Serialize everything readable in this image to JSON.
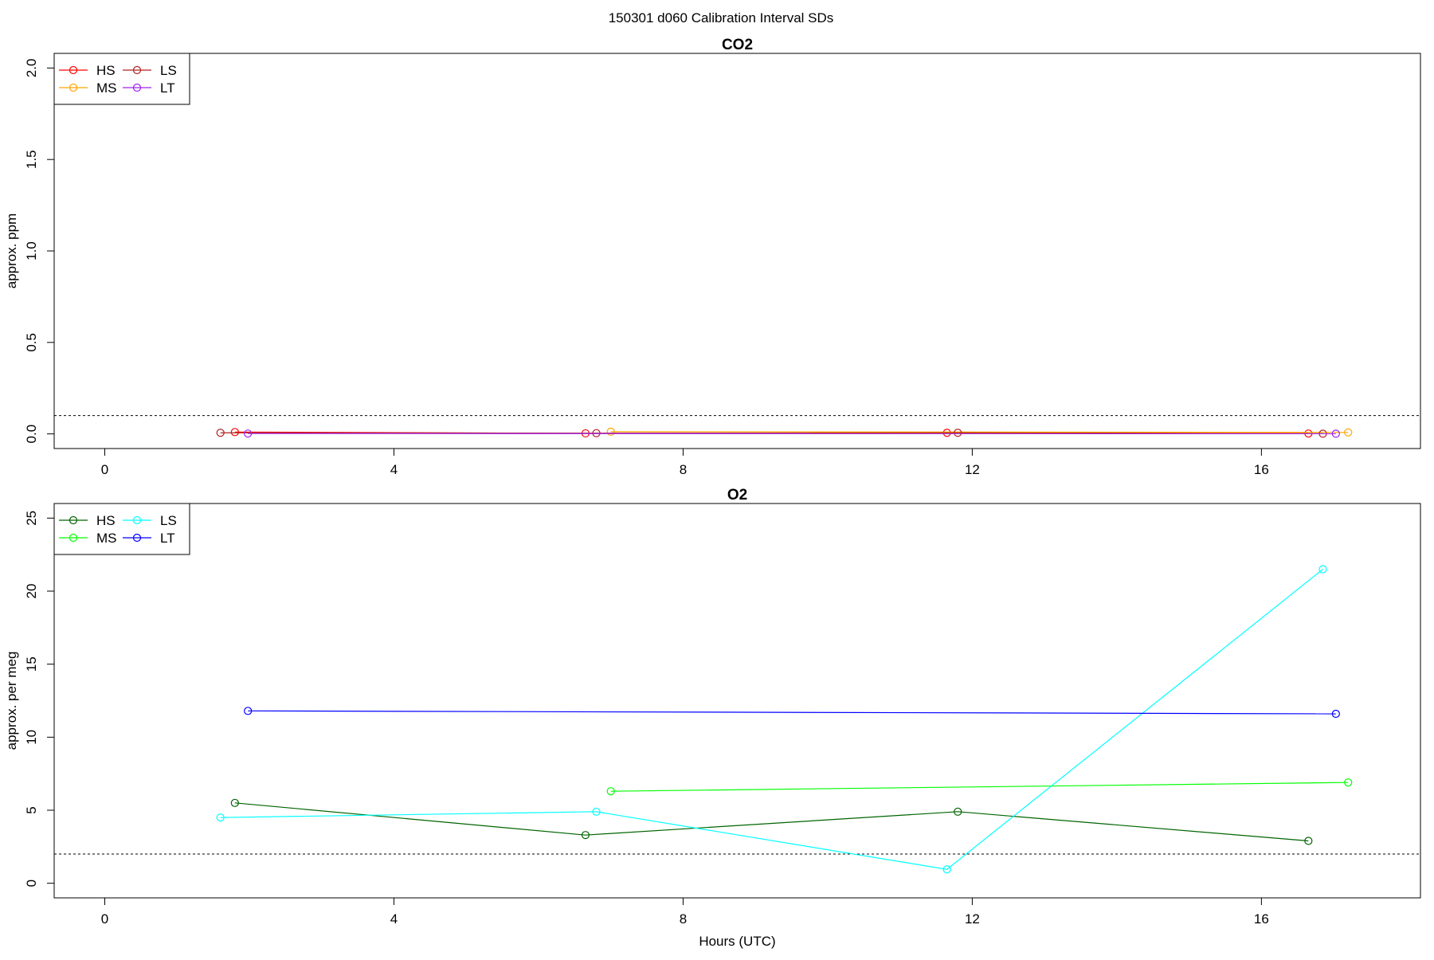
{
  "figure": {
    "suptitle": "150301   d060   Calibration Interval SDs"
  },
  "colors": {
    "HS_co2": "#ff0000",
    "MS_co2": "#ffa500",
    "LS_co2": "#b22222",
    "LT_co2": "#a020f0",
    "HS_o2": "#006400",
    "MS_o2": "#00ff00",
    "LS_o2": "#00ffff",
    "LT_o2": "#0000ff"
  },
  "chart_data": [
    {
      "type": "line",
      "title": "CO2",
      "xlabel": "",
      "ylabel": "approx. ppm",
      "xlim": [
        -0.7,
        18.2
      ],
      "ylim": [
        -0.08,
        2.08
      ],
      "xticks": [
        0,
        4,
        8,
        12,
        16
      ],
      "yticks": [
        0.0,
        0.5,
        1.0,
        1.5,
        2.0
      ],
      "ytick_labels": [
        "0.0",
        "0.5",
        "1.0",
        "1.5",
        "2.0"
      ],
      "threshold": 0.1,
      "grid": false,
      "legend": {
        "position": "top-left",
        "columns": 2
      },
      "series": [
        {
          "name": "HS",
          "color": "#ff0000",
          "x": [
            1.8,
            6.65,
            11.65,
            16.65
          ],
          "y": [
            0.01,
            0.003,
            0.006,
            0.002
          ]
        },
        {
          "name": "MS",
          "color": "#ffa500",
          "x": [
            7.0,
            17.2
          ],
          "y": [
            0.012,
            0.008
          ]
        },
        {
          "name": "LS",
          "color": "#b22222",
          "x": [
            1.6,
            6.8,
            11.8,
            16.85
          ],
          "y": [
            0.006,
            0.004,
            0.006,
            0.001
          ]
        },
        {
          "name": "LT",
          "color": "#a020f0",
          "x": [
            1.98,
            17.03
          ],
          "y": [
            0.002,
            0.001
          ]
        }
      ]
    },
    {
      "type": "line",
      "title": "O2",
      "xlabel": "Hours (UTC)",
      "ylabel": "approx. per meg",
      "xlim": [
        -0.7,
        18.2
      ],
      "ylim": [
        -1.0,
        26.0
      ],
      "xticks": [
        0,
        4,
        8,
        12,
        16
      ],
      "yticks": [
        0,
        5,
        10,
        15,
        20,
        25
      ],
      "ytick_labels": [
        "0",
        "5",
        "10",
        "15",
        "20",
        "25"
      ],
      "threshold": 2.0,
      "grid": false,
      "legend": {
        "position": "top-left",
        "columns": 2
      },
      "series": [
        {
          "name": "HS",
          "color": "#006400",
          "x": [
            1.8,
            6.65,
            11.8,
            16.65
          ],
          "y": [
            5.5,
            3.3,
            4.9,
            2.9
          ]
        },
        {
          "name": "MS",
          "color": "#00ff00",
          "x": [
            7.0,
            17.2
          ],
          "y": [
            6.3,
            6.9
          ]
        },
        {
          "name": "LS",
          "color": "#00ffff",
          "x": [
            1.6,
            6.8,
            11.65,
            16.85
          ],
          "y": [
            4.5,
            4.9,
            0.95,
            21.5
          ]
        },
        {
          "name": "LT",
          "color": "#0000ff",
          "x": [
            1.98,
            17.03
          ],
          "y": [
            11.8,
            11.6
          ]
        }
      ]
    }
  ]
}
